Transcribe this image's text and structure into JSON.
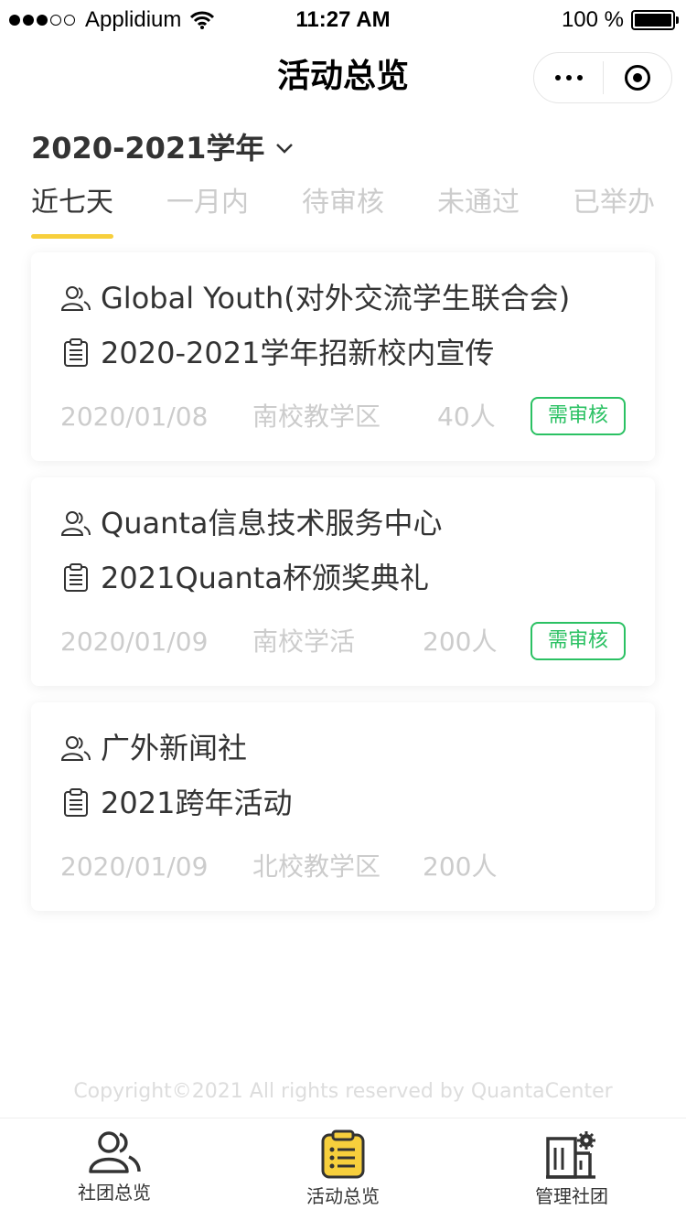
{
  "status_bar": {
    "carrier": "Applidium",
    "time": "11:27 AM",
    "battery": "100 %",
    "battery_level": 1.0
  },
  "nav": {
    "title": "活动总览"
  },
  "year_selector": {
    "value": "2020-2021学年"
  },
  "tabs": [
    {
      "label": "近七天",
      "active": true
    },
    {
      "label": "一月内",
      "active": false
    },
    {
      "label": "待审核",
      "active": false
    },
    {
      "label": "未通过",
      "active": false
    },
    {
      "label": "已举办",
      "active": false
    }
  ],
  "activities": [
    {
      "club": "Global Youth(对外交流学生联合会)",
      "title": "2020-2021学年招新校内宣传",
      "date": "2020/01/08",
      "location": "南校教学区",
      "count": "40人",
      "badge": "需审核"
    },
    {
      "club": "Quanta信息技术服务中心",
      "title": "2021Quanta杯颁奖典礼",
      "date": "2020/01/09",
      "location": "南校学活",
      "count": "200人",
      "badge": "需审核"
    },
    {
      "club": "广外新闻社",
      "title": "2021跨年活动",
      "date": "2020/01/09",
      "location": "北校教学区",
      "count": "200人",
      "badge": ""
    }
  ],
  "copyright": "Copyright©2021 All rights reserved by QuantaCenter",
  "tabbar": [
    {
      "label": "社团总览",
      "icon": "users-icon"
    },
    {
      "label": "活动总览",
      "icon": "clipboard-list-icon",
      "active": true
    },
    {
      "label": "管理社团",
      "icon": "building-gear-icon"
    }
  ],
  "colors": {
    "accent": "#f7cf3c",
    "badge": "#2bc163",
    "muted": "#cccccc"
  }
}
